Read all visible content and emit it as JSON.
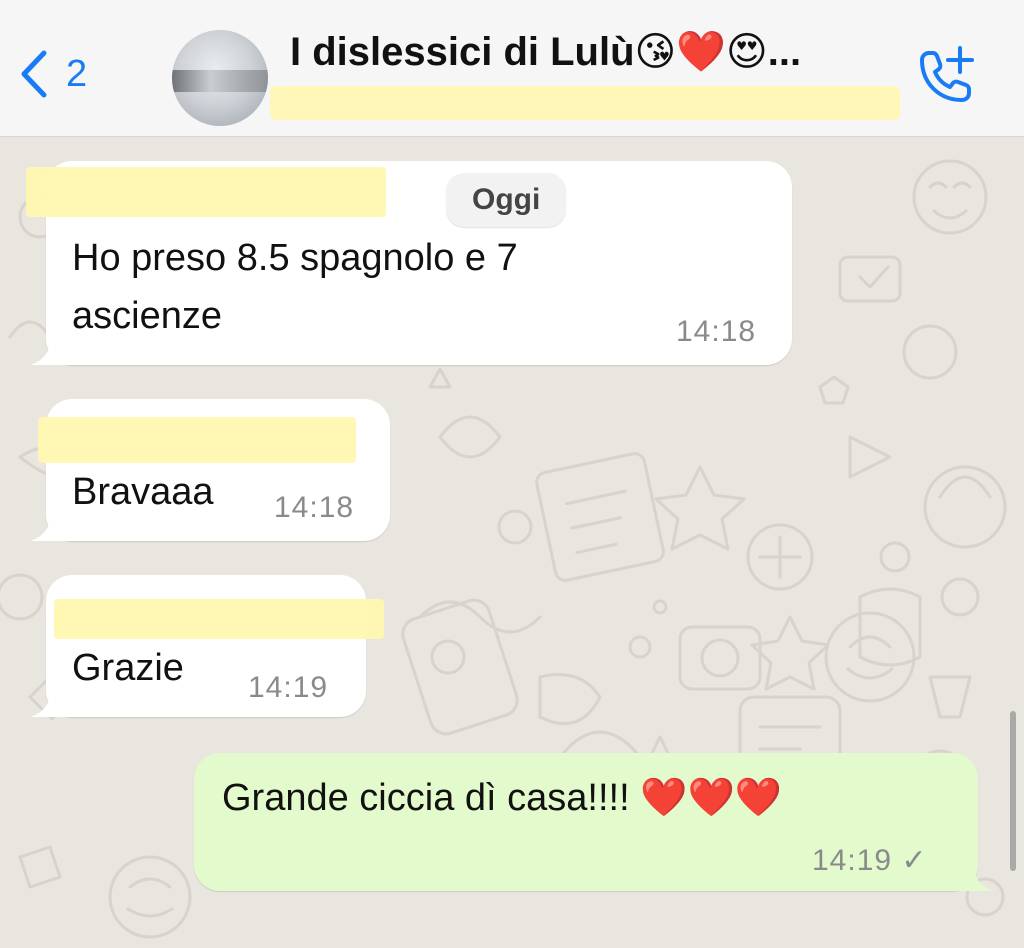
{
  "header": {
    "back_count": "2",
    "group_title": "I dislessici di Lulù😘❤️😍...",
    "back_icon": "chevron-left-icon",
    "call_icon": "add-call-icon"
  },
  "chat": {
    "date_divider": "Oggi",
    "messages": [
      {
        "direction": "incoming",
        "text": "Ho preso 8.5 spagnolo e 7\nascienze",
        "time": "14:18"
      },
      {
        "direction": "incoming",
        "text": "Bravaaa",
        "time": "14:18"
      },
      {
        "direction": "incoming",
        "text": "Grazie",
        "time": "14:19"
      },
      {
        "direction": "outgoing",
        "text": "Grande ciccia dì casa!!!! ❤️❤️❤️",
        "time": "14:19 ✓"
      }
    ]
  },
  "colors": {
    "accent": "#1a7cf5",
    "outgoing_bubble": "#e3fbcc",
    "incoming_bubble": "#ffffff",
    "chat_background": "#e9e5df",
    "redaction_highlight": "#fff7b0"
  }
}
